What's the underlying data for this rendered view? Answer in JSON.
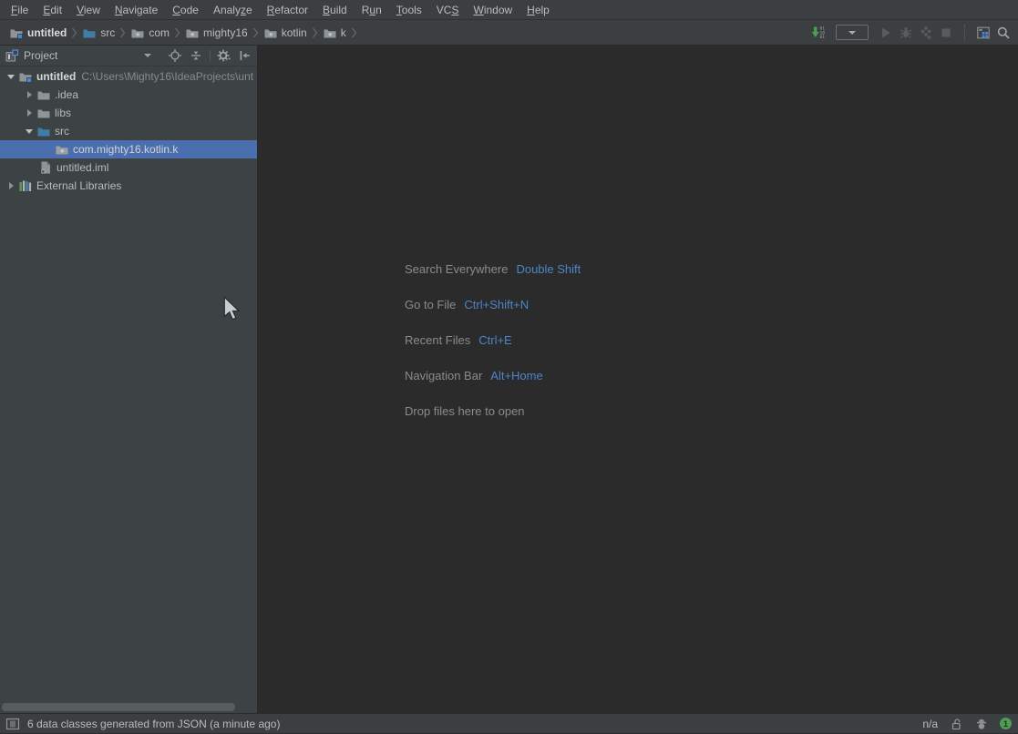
{
  "colors": {
    "bar_bg": "#3C3F41",
    "panel_bg": "#3D4245",
    "editor_bg": "#2B2B2B",
    "selection_bg": "#4B6EAF",
    "text": "#BBBBBB",
    "muted_text": "#8A8A8A",
    "shortcut_key_blue": "#4C85C7",
    "badge_green": "#4C9E53",
    "src_folder_blue": "#417CA3",
    "make_arrow_green": "#4C9E53"
  },
  "menu_bar": {
    "items": [
      {
        "pre": "",
        "key": "F",
        "post": "ile"
      },
      {
        "pre": "",
        "key": "E",
        "post": "dit"
      },
      {
        "pre": "",
        "key": "V",
        "post": "iew"
      },
      {
        "pre": "",
        "key": "N",
        "post": "avigate"
      },
      {
        "pre": "",
        "key": "C",
        "post": "ode"
      },
      {
        "pre": "Analy",
        "key": "z",
        "post": "e"
      },
      {
        "pre": "",
        "key": "R",
        "post": "efactor"
      },
      {
        "pre": "",
        "key": "B",
        "post": "uild"
      },
      {
        "pre": "R",
        "key": "u",
        "post": "n"
      },
      {
        "pre": "",
        "key": "T",
        "post": "ools"
      },
      {
        "pre": "VC",
        "key": "S",
        "post": ""
      },
      {
        "pre": "",
        "key": "W",
        "post": "indow"
      },
      {
        "pre": "",
        "key": "H",
        "post": "elp"
      }
    ]
  },
  "breadcrumb_bar": {
    "items": [
      {
        "label": "untitled",
        "icon": "project-folder"
      },
      {
        "label": "src",
        "icon": "source-folder"
      },
      {
        "label": "com",
        "icon": "package"
      },
      {
        "label": "mighty16",
        "icon": "package"
      },
      {
        "label": "kotlin",
        "icon": "package"
      },
      {
        "label": "k",
        "icon": "package"
      }
    ]
  },
  "run_toolbar": {
    "buttons": [
      "make-project",
      "run-configurations-dropdown",
      "run",
      "debug",
      "run-with-coverage",
      "stop",
      "project-structure",
      "search-everywhere"
    ]
  },
  "project_panel": {
    "header": {
      "title": "Project"
    },
    "tree": [
      {
        "label": "untitled",
        "path": "C:\\Users\\Mighty16\\IdeaProjects\\unt",
        "icon": "project-folder",
        "state": "expanded"
      },
      {
        "label": ".idea",
        "icon": "folder",
        "state": "collapsed"
      },
      {
        "label": "libs",
        "icon": "folder",
        "state": "collapsed"
      },
      {
        "label": "src",
        "icon": "source-folder",
        "state": "expanded"
      },
      {
        "label": "com.mighty16.kotlin.k",
        "icon": "package",
        "state": "selected"
      },
      {
        "label": "untitled.iml",
        "icon": "module-file",
        "state": "leaf"
      },
      {
        "label": "External Libraries",
        "icon": "libraries",
        "state": "collapsed"
      }
    ]
  },
  "editor": {
    "shortcut_hints": [
      {
        "action": "Search Everywhere",
        "keys": "Double Shift"
      },
      {
        "action": "Go to File",
        "keys": "Ctrl+Shift+N"
      },
      {
        "action": "Recent Files",
        "keys": "Ctrl+E"
      },
      {
        "action": "Navigation Bar",
        "keys": "Alt+Home"
      },
      {
        "action": "Drop files here to open",
        "keys": ""
      }
    ]
  },
  "status_bar": {
    "message": "6 data classes generated from JSON (a minute ago)",
    "memory_indicator": "n/a",
    "notification_count": "1"
  }
}
